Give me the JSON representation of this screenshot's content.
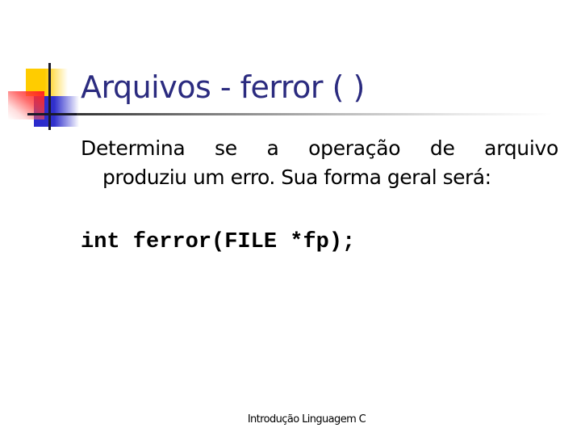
{
  "slide": {
    "title": "Arquivos - ferror ( )",
    "body": {
      "line1": "Determina se a operação de arquivo",
      "line2": "produziu um erro. Sua forma geral será:"
    },
    "code": "int ferror(FILE *fp);",
    "footer": "Introdução Linguagem C"
  },
  "colors": {
    "title": "#2b2b7f",
    "text": "#000000",
    "accent_yellow": "#ffcc00",
    "accent_blue": "#2a2acc",
    "accent_red": "#ff2020"
  },
  "decorations": {
    "logo_icon": "overlapping-squares-logo",
    "title_rule": "gradient-horizontal-rule"
  }
}
